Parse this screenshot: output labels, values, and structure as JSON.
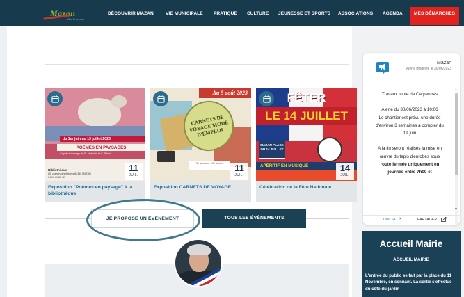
{
  "nav": {
    "logo_text": "Mazan",
    "logo_tagline": "Ville Provence",
    "items": [
      {
        "label": "DÉCOUVRIR MAZAN"
      },
      {
        "label": "VIE MUNICIPALE"
      },
      {
        "label": "PRATIQUE"
      },
      {
        "label": "CULTURE"
      },
      {
        "label": "JEUNESSE ET SPORTS"
      },
      {
        "label": "ASSOCIATIONS"
      },
      {
        "label": "AGENDA"
      },
      {
        "label": "MES DÉMARCHES"
      }
    ],
    "active_color": "#e1221d",
    "bar_color": "#183a4d"
  },
  "events": [
    {
      "title": "Exposition \"Poèmes en paysage\" à la bibliothèque",
      "day": "11",
      "month": "JUIL.",
      "poster": {
        "ribbon1": "du 1er juin au 13 juillet 2023",
        "ribbon2": "POÈMES EN PAYSAGES",
        "ribbon3": "d'après l'ouvrage de R. Heinrich et C. Stehl",
        "foot1": "Bibliothèque",
        "foot2": "85, chemin des Ateliers 84380 MAZAN",
        "foot3": "04 90 69 82 92"
      }
    },
    {
      "title": "Exposition CARNETS DE VOYAGE",
      "day": "11",
      "month": "JUIL.",
      "poster": {
        "top": "Au 5 août 2023",
        "stamp": "CARNETS DE VOYAGE MODE D'EMPLOI",
        "note": "\"Je suis une ville photo\""
      }
    },
    {
      "title": "Célébration de la Fête Nationale",
      "day": "14",
      "month": "JUIL.",
      "poster": {
        "t1": "FÊTER",
        "t2": "LE 14 JUILLET",
        "sign": "MAZAN PLACE DU 14 JUILLET",
        "bar": "APÉRITIF EN MUSIQUE"
      }
    }
  ],
  "buttons": {
    "propose": "JE PROPOSE UN ÉVÈNEMENT",
    "all_events": "TOUS LES ÉVÈNEMENTS"
  },
  "alert": {
    "town": "Mazan",
    "modified": "Alerte modifiée le 30/06/2023",
    "lines": [
      "Travaux route de Carpentras",
      "- - - - - - -",
      "Alerte du 30/06/2023 à 10:06",
      "Le chantier est prévu une durée d'environ 3 semaines à compter du 19 juin",
      "- - - - - - - - -",
      "A la fin seront réalisés la mise en œuvre du tapis d'enrobés sous",
      "route fermée uniquement en journée entre 7h00 et"
    ],
    "pager": "1 sur 14",
    "next": "›",
    "share": "PARTAGER"
  },
  "accueil": {
    "title": "Accueil Mairie",
    "subtitle": "ACCUEIL MAIRIE",
    "text": "L'entrée du public se fait par la place du 11 Novembre, en sonnant. La sortie s'effectue du côté du jardin"
  }
}
